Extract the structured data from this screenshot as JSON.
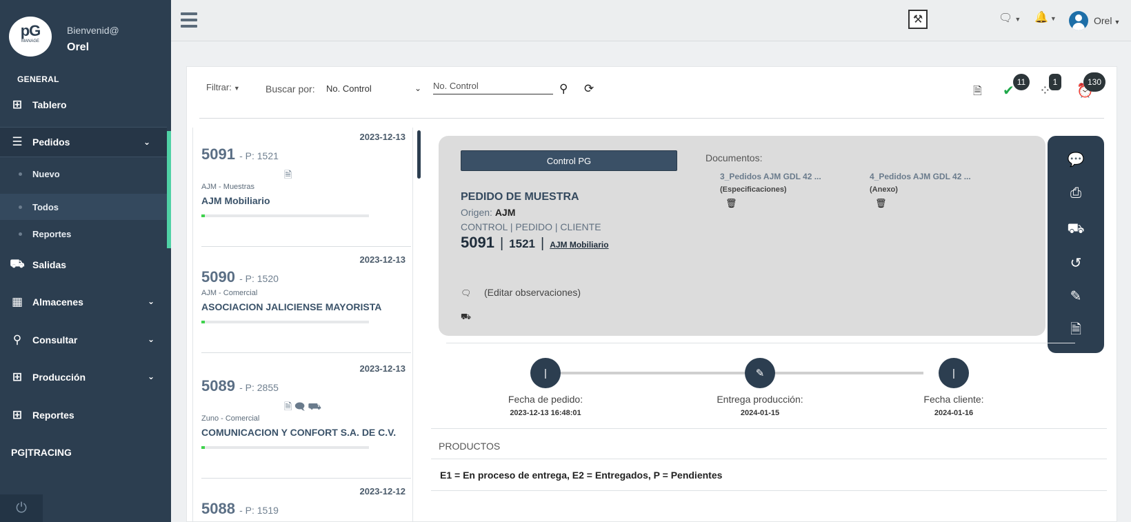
{
  "sidebar": {
    "logo_big": "pG",
    "logo_small": "MANAGE",
    "welcome": "Bienvenid@",
    "user": "Orel",
    "section": "GENERAL",
    "items": {
      "tablero": "Tablero",
      "pedidos": "Pedidos",
      "salidas": "Salidas",
      "almacenes": "Almacenes",
      "consultar": "Consultar",
      "produccion": "Producción",
      "reportes": "Reportes"
    },
    "pedidos_sub": {
      "nuevo": "Nuevo",
      "todos": "Todos",
      "reportes": "Reportes"
    },
    "pgtracing": "PG|TRACING"
  },
  "topbar": {
    "user": "Orel"
  },
  "filters": {
    "filtrar": "Filtrar:",
    "buscar_por": "Buscar por:",
    "buscar_select": "No. Control",
    "search_placeholder": "No. Control"
  },
  "status_badges": {
    "completed": "11",
    "in_progress": "1",
    "late": "130"
  },
  "orders": [
    {
      "date": "2023-12-13",
      "control": "5091",
      "pedido": "- P: 1521",
      "category": "AJM - Muestras",
      "client": "AJM Mobiliario",
      "progress": 0.02
    },
    {
      "date": "2023-12-13",
      "control": "5090",
      "pedido": "- P: 1520",
      "category": "AJM - Comercial",
      "client": "ASOCIACION JALICIENSE MAYORISTA",
      "progress": 0.02
    },
    {
      "date": "2023-12-13",
      "control": "5089",
      "pedido": "- P: 2855",
      "category": "Zuno - Comercial",
      "client": "COMUNICACION Y CONFORT S.A. DE C.V.",
      "progress": 0.02
    },
    {
      "date": "2023-12-12",
      "control": "5088",
      "pedido": "- P: 1519"
    }
  ],
  "detail": {
    "control_button": "Control PG",
    "title": "PEDIDO DE MUESTRA",
    "origin_label": "Origen:",
    "origin_value": "AJM",
    "control_line": "CONTROL | PEDIDO | CLIENTE",
    "control_no": "5091",
    "pedido_no": "1521",
    "client": "AJM Mobiliario",
    "observaciones": "(Editar observaciones)",
    "documents_label": "Documentos:",
    "documents": [
      {
        "name": "3_Pedidos AJM GDL 42 ...",
        "type": "(Especificaciones)"
      },
      {
        "name": "4_Pedidos AJM GDL 42 ...",
        "type": "(Anexo)"
      }
    ]
  },
  "timeline": [
    {
      "label": "Fecha de pedido:",
      "value": "2023-12-13 16:48:01"
    },
    {
      "label": "Entrega producción:",
      "value": "2024-01-15"
    },
    {
      "label": "Fecha cliente:",
      "value": "2024-01-16"
    }
  ],
  "products": {
    "title": "PRODUCTOS",
    "legend": "E1 = En proceso de entrega, E2 = Entregados, P = Pendientes"
  },
  "colors": {
    "sidebar": "#2c3e50",
    "accent": "#4fd1a5",
    "progress": "#3fd24d",
    "ok": "#1fa84a",
    "late": "#d62a2a"
  }
}
